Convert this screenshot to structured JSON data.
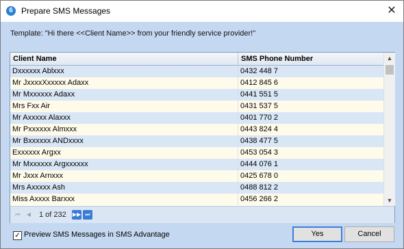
{
  "window": {
    "title": "Prepare SMS Messages",
    "icon_glyph": "6",
    "close_glyph": "✕"
  },
  "template": "Template: \"Hi there <<Client Name>> from your friendly service provider!\"",
  "grid": {
    "columns": [
      "Client Name",
      "SMS Phone Number"
    ],
    "rows": [
      {
        "name": "Dxxxxxx Ablxxx",
        "phone": "0432 448 7"
      },
      {
        "name": "Mr JxxxxXxxxxx Adaxx",
        "phone": "0412 845 6"
      },
      {
        "name": "Mr Mxxxxxx Adaxx",
        "phone": "0441 551 5"
      },
      {
        "name": "Mrs Fxx Air",
        "phone": "0431 537 5"
      },
      {
        "name": "Mr Axxxxx Alaxxx",
        "phone": "0401 770 2"
      },
      {
        "name": "Mr Pxxxxxx Almxxx",
        "phone": "0443 824 4"
      },
      {
        "name": "Mr Bxxxxxx ANDxxxx",
        "phone": "0438 477 5"
      },
      {
        "name": "Exxxxxx Argxx",
        "phone": "0453 054 3"
      },
      {
        "name": "Mr Mxxxxxx Argxxxxxx",
        "phone": "0444 076 1"
      },
      {
        "name": "Mr Jxxx Arnxxx",
        "phone": "0425 678 0"
      },
      {
        "name": "Mrs Axxxxx Ash",
        "phone": "0488 812 2"
      },
      {
        "name": "Miss Axxxx Barxxx",
        "phone": "0456 266 2"
      }
    ],
    "pager": {
      "page_info": "1 of 232",
      "first_icon": "first-page-icon",
      "prev_icon": "prev-page-icon",
      "next_icon": "next-page-icon",
      "last_icon": "last-page-icon"
    }
  },
  "preview": {
    "label": "Preview SMS Messages in SMS Advantage",
    "checked": true,
    "check_glyph": "✓"
  },
  "buttons": {
    "yes": "Yes",
    "cancel": "Cancel"
  },
  "colors": {
    "dialog_bg": "#c5d8f1",
    "row_even": "#d8e6f5",
    "row_odd": "#fffbea",
    "accent": "#3c7fd9"
  }
}
